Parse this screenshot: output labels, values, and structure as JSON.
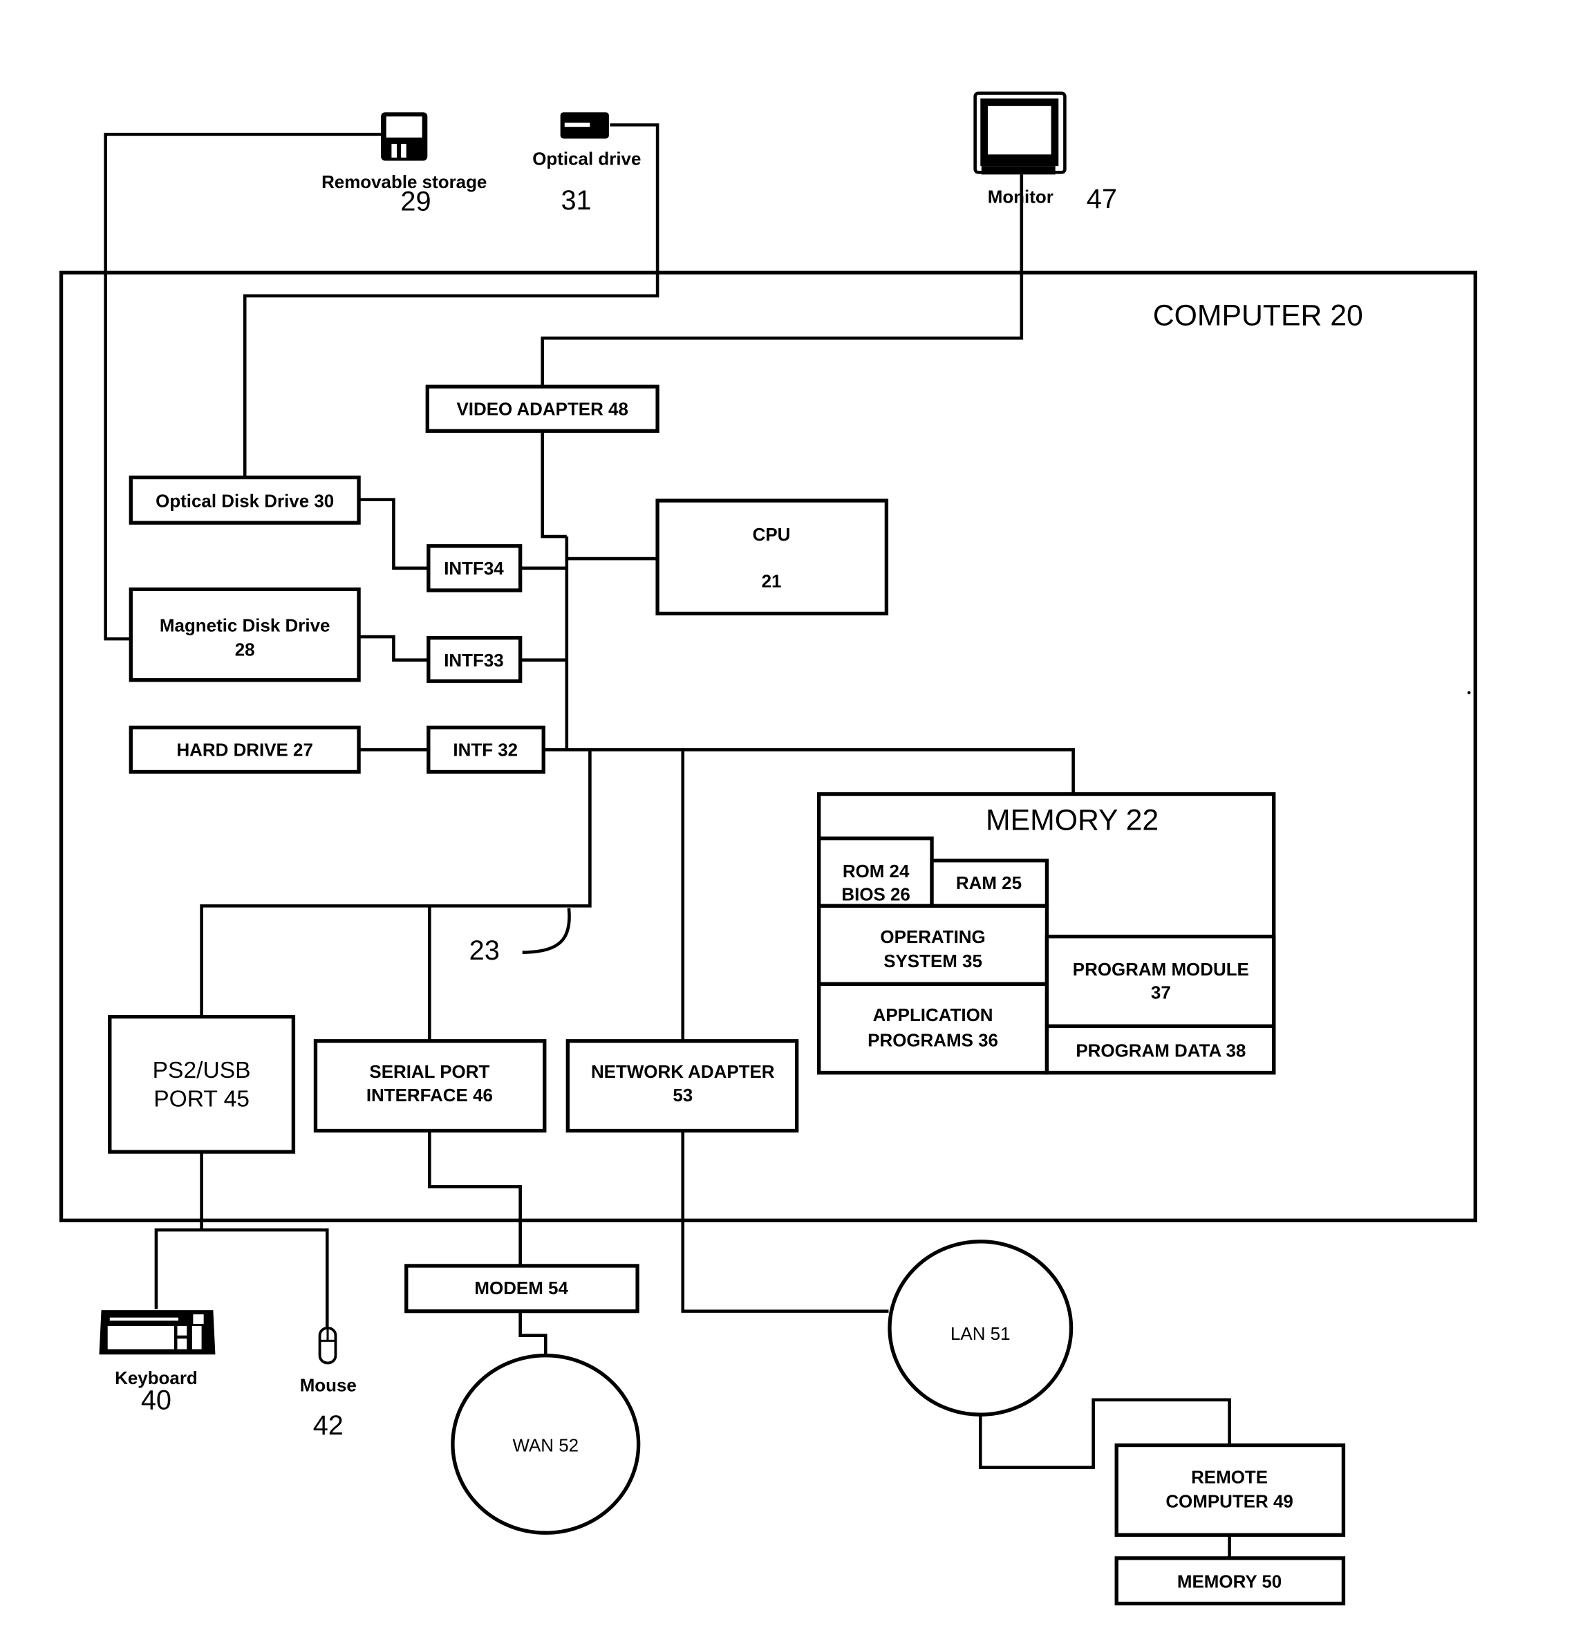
{
  "diagram": {
    "computer": {
      "label": "COMPUTER 20"
    },
    "peripherals": {
      "removable_storage": {
        "label": "Removable storage",
        "number": "29"
      },
      "optical_drive": {
        "label": "Optical drive",
        "number": "31"
      },
      "monitor": {
        "label": "Monitor",
        "number": "47"
      },
      "keyboard": {
        "label": "Keyboard",
        "number": "40"
      },
      "mouse": {
        "label": "Mouse",
        "number": "42"
      }
    },
    "blocks": {
      "video_adapter": "VIDEO ADAPTER 48",
      "optical_disk_drive": "Optical Disk Drive 30",
      "magnetic_disk_drive": [
        "Magnetic Disk Drive",
        "28"
      ],
      "hard_drive": "HARD DRIVE 27",
      "intf34": "INTF34",
      "intf33": "INTF33",
      "intf32": "INTF 32",
      "cpu": [
        "CPU",
        "21"
      ],
      "ps2_usb_port": [
        "PS2/USB",
        "PORT 45"
      ],
      "serial_port_interface": [
        "SERIAL PORT",
        "INTERFACE 46"
      ],
      "network_adapter": [
        "NETWORK ADAPTER",
        "53"
      ],
      "modem": "MODEM 54",
      "remote_computer": [
        "REMOTE",
        "COMPUTER 49"
      ],
      "remote_memory": "MEMORY 50"
    },
    "memory": {
      "title": "MEMORY 22",
      "rom_bios": [
        "ROM 24",
        "BIOS 26"
      ],
      "ram": "RAM 25",
      "operating_system": [
        "OPERATING",
        "SYSTEM 35"
      ],
      "application_programs": [
        "APPLICATION",
        "PROGRAMS 36"
      ],
      "program_module": [
        "PROGRAM MODULE",
        "37"
      ],
      "program_data": "PROGRAM DATA 38"
    },
    "bus": {
      "label": "23"
    },
    "networks": {
      "wan": "WAN 52",
      "lan": "LAN 51"
    }
  }
}
